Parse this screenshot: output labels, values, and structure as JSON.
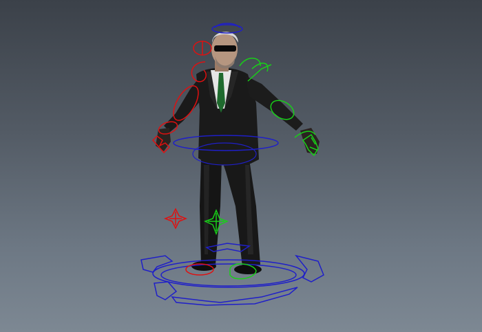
{
  "viewport": {
    "background_top": "#3b4149",
    "background_bottom": "#7d8893"
  },
  "rig_colors": {
    "center": "#1f1fc8",
    "left_side": "#e01010",
    "right_side": "#18d018"
  },
  "character": {
    "suit_color": "#161616",
    "shirt_color": "#e8e8e8",
    "tie_color": "#1e6b2e",
    "skin_color": "#b99a82",
    "hair_color": "#d8d8d8",
    "shoe_color": "#0f0f0f"
  }
}
